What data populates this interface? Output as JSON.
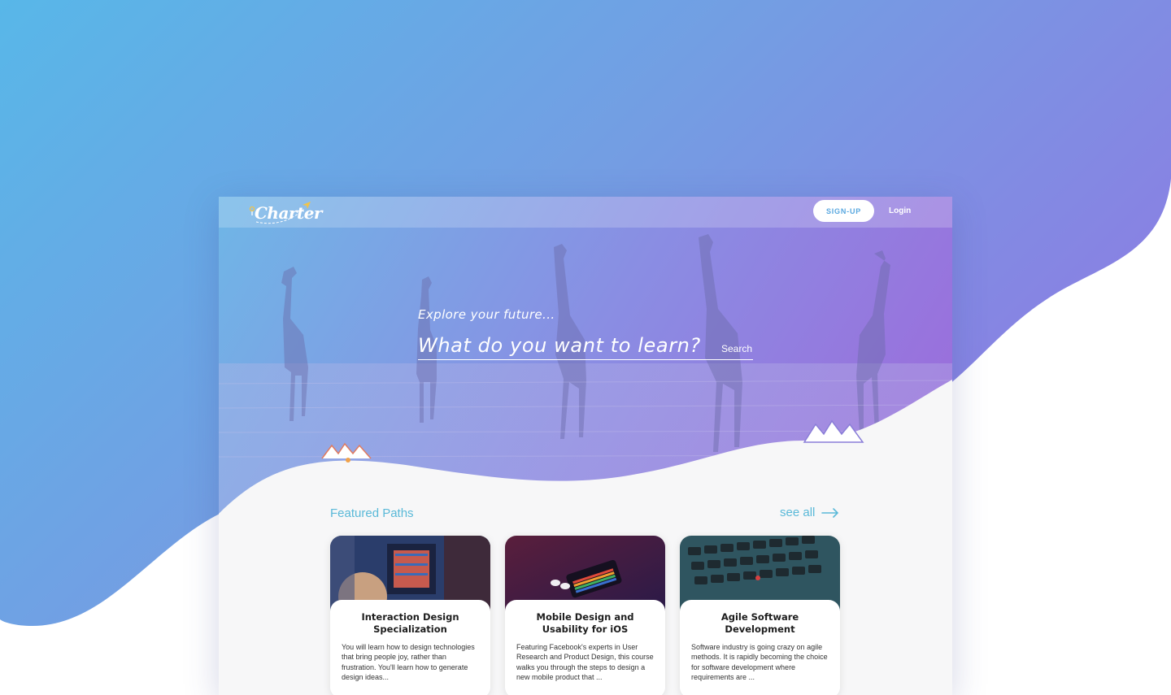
{
  "brand": {
    "logo_text": "Charter"
  },
  "nav": {
    "signup_label": "SIGN-UP",
    "login_label": "Login"
  },
  "hero": {
    "tagline": "Explore your future...",
    "search_placeholder": "What do you want to learn?",
    "search_button": "Search"
  },
  "featured": {
    "title": "Featured Paths",
    "see_all": "see all",
    "cards": [
      {
        "title": "Interaction Design Specialization",
        "description": "You will learn how to design technologies that bring people joy, rather than frustration. You'll learn how to generate design ideas..."
      },
      {
        "title": "Mobile Design and Usability for iOS",
        "description": "Featuring Facebook's experts in User Research and Product Design, this course walks you through the steps to design a new mobile product that ..."
      },
      {
        "title": "Agile Software Development",
        "description": "Software industry is going crazy on agile methods.  It is rapidly becoming the choice for software development where requirements are ..."
      }
    ]
  },
  "colors": {
    "gradient_start": "#5bb8e8",
    "gradient_end": "#8c7ee3",
    "accent": "#5ab9d8",
    "hero_purple": "#9b78e0"
  },
  "icons": [
    "arrow-right-icon",
    "pin-icon",
    "plane-icon",
    "mountain-icon"
  ]
}
